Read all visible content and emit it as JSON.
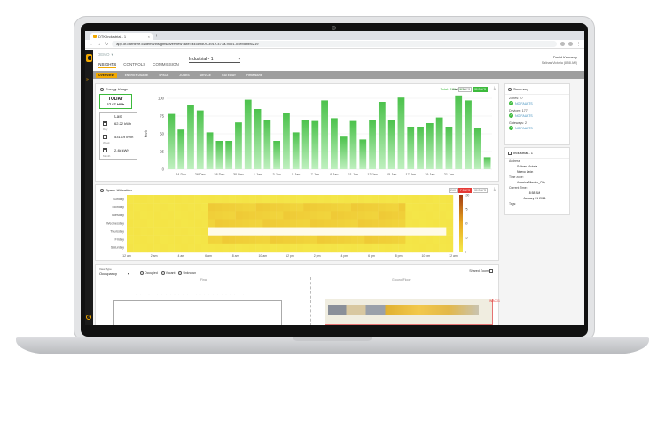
{
  "browser": {
    "tab_title": "DTK Industrial - 1",
    "tab_close": "×",
    "new_tab": "+",
    "url": "app.ot.darntree.io/demo/insights/overview?site=a45a9d09-391e-473a-9091-04ebdfbb6219"
  },
  "header": {
    "org": "DEMO",
    "site_select": "Industrial - 1",
    "nav_tabs": [
      "INSIGHTS",
      "CONTROLS",
      "COMMISSION"
    ],
    "user_name": "David Kennedy",
    "user_sub": "Salinas Victoria (8:58 AM)"
  },
  "subnav": [
    "OVERVIEW",
    "ENERGY USAGE",
    "SPACE",
    "ZONES",
    "DEVICE",
    "GATEWAY",
    "FIRMWARE"
  ],
  "energy": {
    "title": "Energy Usage",
    "today_label": "TODAY",
    "today_value": "17.87 kWh",
    "last_title": "Last",
    "last_items": [
      {
        "value": "62.22 kWh",
        "label": "Day"
      },
      {
        "value": "531.19 kWh",
        "label": "Week"
      },
      {
        "value": "2.4k kWh",
        "label": "Month"
      }
    ],
    "total": "Total: 2.2k kWh",
    "range_label": "Last",
    "range_options": [
      "7 DAYS",
      "30 DAYS"
    ],
    "range_active": "30 DAYS",
    "download_icon": "download-icon"
  },
  "chart_data": [
    {
      "type": "bar",
      "ylabel": "kWh",
      "ylim": [
        0,
        100
      ],
      "yticks": [
        0,
        25,
        50,
        75,
        100
      ],
      "xtick_labels": [
        "24 Dec",
        "26 Dec",
        "28 Dec",
        "30 Dec",
        "1 Jan",
        "3 Jan",
        "5 Jan",
        "7 Jan",
        "9 Jan",
        "11 Jan",
        "13 Jan",
        "15 Jan",
        "17 Jan",
        "19 Jan",
        "21 Jan"
      ],
      "values": [
        78,
        56,
        91,
        83,
        52,
        40,
        40,
        66,
        98,
        85,
        70,
        40,
        79,
        52,
        70,
        68,
        97,
        72,
        46,
        68,
        42,
        70,
        95,
        69,
        101,
        60,
        60,
        65,
        73,
        60,
        104,
        97,
        58,
        17
      ],
      "color": "#4cc24c",
      "grid": true
    },
    {
      "type": "heatmap",
      "title": "Space Utilization",
      "rows": [
        "Sunday",
        "Monday",
        "Tuesday",
        "Wednesday",
        "Thursday",
        "Friday",
        "Saturday"
      ],
      "xtick_labels": [
        "12 am",
        "2 am",
        "4 am",
        "6 am",
        "8 am",
        "10 am",
        "12 pm",
        "2 pm",
        "4 pm",
        "6 pm",
        "8 pm",
        "10 pm",
        "12 am"
      ],
      "scale_max": 100,
      "scale_labels": [
        "100",
        "75",
        "50",
        "25",
        "0"
      ],
      "colors": [
        "#f5e94a",
        "#e8a81f",
        "#a23a12"
      ],
      "controls": [
        "24H",
        "7 DAYS",
        "30 DAYS"
      ],
      "control_active": "7 DAYS"
    }
  ],
  "floor": {
    "view_type_label": "View Type",
    "view_type": "Occupancy",
    "legend": [
      "Occupied",
      "Vacant",
      "Unknown"
    ],
    "shared_zoom": "Shared Zoom",
    "final_title": "Final",
    "ground_title": "Ground Floor",
    "wac_label": "WAC01"
  },
  "summary": {
    "title": "Summary",
    "zones_label": "Zones: 27",
    "devices_label": "Devices: 177",
    "gateways_label": "Gateways: 2",
    "status": "NO FAULTS"
  },
  "site": {
    "title": "Industrial - 1",
    "address_label": "Address",
    "address_1": "Salinas Victoria",
    "address_2": "Nuevo León",
    "timezone_label": "Time zone:",
    "timezone": "America/Mexico_City",
    "current_time_label": "Current Time:",
    "current_time": "8:58 AM",
    "current_date": "January 21 2021",
    "tags_label": "Tags:"
  }
}
